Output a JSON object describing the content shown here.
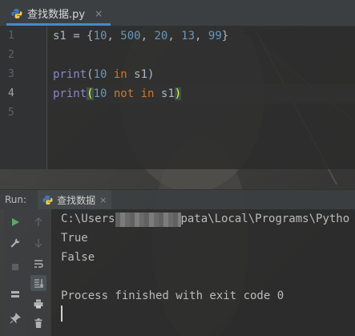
{
  "editor_tab": {
    "filename": "查找数据.py",
    "close_glyph": "×",
    "icon": "python-file-icon"
  },
  "gutter": {
    "line_numbers": [
      "1",
      "2",
      "3",
      "4",
      "5"
    ]
  },
  "code": {
    "line1": {
      "var": "s1",
      "op": " = {",
      "n1": "10",
      "sep1": ", ",
      "n2": "500",
      "sep2": ", ",
      "n3": "20",
      "sep3": ", ",
      "n4": "13",
      "sep4": ", ",
      "n5": "99",
      "close": "}"
    },
    "line3": {
      "fn": "print",
      "open": "(",
      "num": "10",
      "kw": " in ",
      "var": "s1",
      "close": ")"
    },
    "line4": {
      "fn": "print",
      "open": "(",
      "num": "10",
      "kw": " not in ",
      "var": "s1",
      "close": ")"
    }
  },
  "run_panel": {
    "title": "Run:",
    "tab_label": "查找数据",
    "tab_close": "×",
    "console": {
      "path_prefix": "C:\\Users",
      "path_suffix": "pata\\Local\\Programs\\Pytho",
      "output": [
        "True",
        "False"
      ],
      "finish": "Process finished with exit code 0"
    }
  },
  "colors": {
    "keyword": "#cc7832",
    "number": "#6897bb",
    "builtin": "#8888c6",
    "text": "#a9b7c6",
    "run_green": "#59a869",
    "tab_underline": "#4a88c7"
  }
}
